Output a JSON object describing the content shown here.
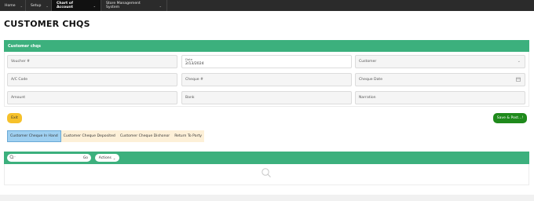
{
  "nav": {
    "items": [
      {
        "label": "Home"
      },
      {
        "label": "Setup"
      },
      {
        "label": "Chart of Account"
      },
      {
        "label": "Store Management System"
      }
    ]
  },
  "page": {
    "title": "CUSTOMER CHQS"
  },
  "panel": {
    "title": "Customer chqs"
  },
  "form": {
    "voucher_label": "Voucher #",
    "date_label": "Date",
    "date_value": "2/13/2024",
    "customer_label": "Customer",
    "ac_code_label": "A/C Code",
    "cheque_no_label": "Cheque #",
    "cheque_date_label": "Cheque Date",
    "amount_label": "Amount",
    "bank_label": "Bank",
    "narration_label": "Narration"
  },
  "buttons": {
    "exit": "Exit",
    "save_post": "Save & Post...!"
  },
  "tabs": [
    {
      "label": "Customer Cheque In Hand"
    },
    {
      "label": "Customer Cheque Deposited"
    },
    {
      "label": "Customer Cheque Dishonor"
    },
    {
      "label": "Return To Party"
    }
  ],
  "toolbar": {
    "go": "Go",
    "actions": "Actions"
  },
  "colors": {
    "accent_green": "#3cb07d",
    "save_green": "#1f8a1c",
    "exit_yellow": "#f6c12b",
    "nav_bg": "#2b2b2b"
  }
}
